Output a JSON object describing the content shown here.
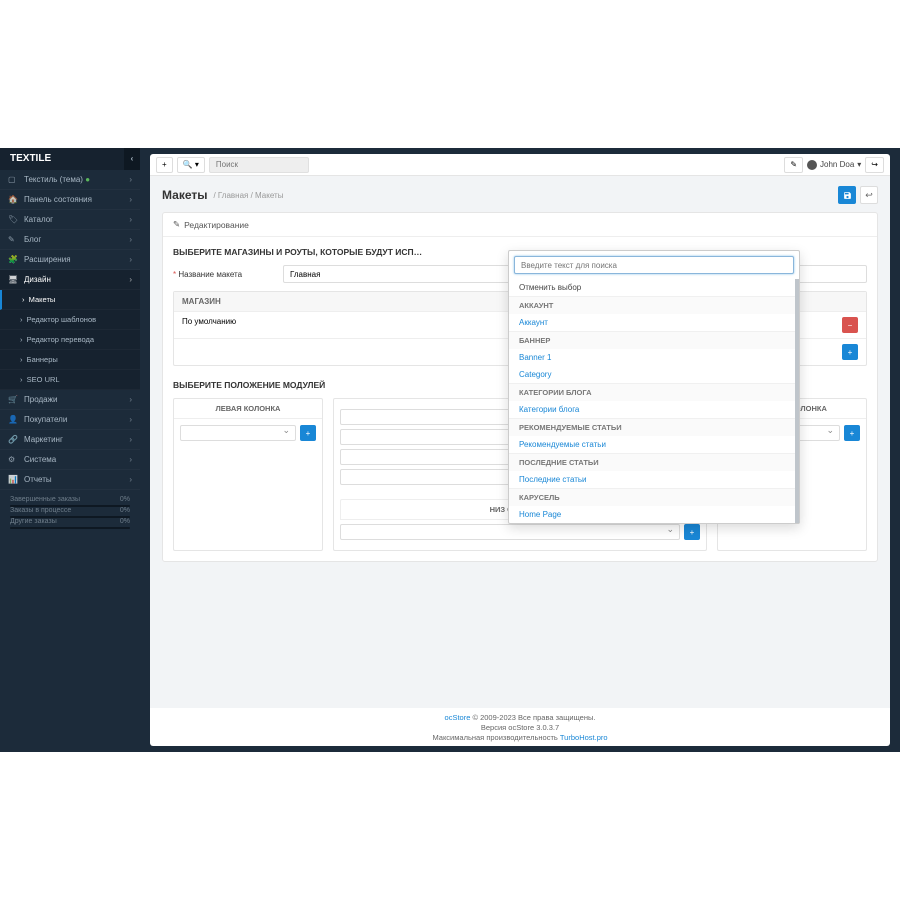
{
  "brand": "TEXTILE",
  "header": {
    "search_placeholder": "Поиск",
    "user_name": "John Doa"
  },
  "sidebar": {
    "items": [
      {
        "icon": "▢",
        "label": "Текстиль (тема)",
        "dot": true
      },
      {
        "icon": "🏠",
        "label": "Панель состояния"
      },
      {
        "icon": "🏷",
        "label": "Каталог"
      },
      {
        "icon": "✎",
        "label": "Блог"
      },
      {
        "icon": "🧩",
        "label": "Расширения"
      },
      {
        "icon": "🖥",
        "label": "Дизайн",
        "open": true
      },
      {
        "icon": "🛒",
        "label": "Продажи"
      },
      {
        "icon": "👤",
        "label": "Покупатели"
      },
      {
        "icon": "🔗",
        "label": "Маркетинг"
      },
      {
        "icon": "⚙",
        "label": "Система"
      },
      {
        "icon": "📊",
        "label": "Отчеты"
      }
    ],
    "design_sub": [
      {
        "label": "Макеты",
        "active": true
      },
      {
        "label": "Редактор шаблонов"
      },
      {
        "label": "Редактор перевода"
      },
      {
        "label": "Баннеры"
      },
      {
        "label": "SEO URL"
      }
    ],
    "status": [
      {
        "label": "Завершенные заказы",
        "pct": "0%"
      },
      {
        "label": "Заказы в процессе",
        "pct": "0%"
      },
      {
        "label": "Другие заказы",
        "pct": "0%"
      }
    ]
  },
  "page": {
    "title": "Макеты",
    "crumb1": "Главная",
    "crumb2": "Макеты",
    "panel_title": "Редактирование",
    "section1": "ВЫБЕРИТЕ МАГАЗИНЫ И РОУТЫ, КОТОРЫЕ БУДУТ ИСП…",
    "name_label": "Название макета",
    "name_value": "Главная",
    "th_shop": "МАГАЗИН",
    "td_shop": "По умолчанию",
    "section2": "ВЫБЕРИТЕ ПОЛОЖЕНИЕ МОДУЛЕЙ",
    "col_left": "ЛЕВАЯ КОЛОНКА",
    "col_right": "ПРАВАЯ КОЛОНКА",
    "col_bottom": "НИЗ СТРАНИЦЫ"
  },
  "dropdown": {
    "search_placeholder": "Введите текст для поиска",
    "clear": "Отменить выбор",
    "groups": [
      {
        "title": "АККАУНТ",
        "items": [
          "Аккаунт"
        ]
      },
      {
        "title": "БАННЕР",
        "items": [
          "Banner 1",
          "Category"
        ]
      },
      {
        "title": "КАТЕГОРИИ БЛОГА",
        "items": [
          "Категории блога"
        ]
      },
      {
        "title": "РЕКОМЕНДУЕМЫЕ СТАТЬИ",
        "items": [
          "Рекомендуемые статьи"
        ]
      },
      {
        "title": "ПОСЛЕДНИЕ СТАТЬИ",
        "items": [
          "Последние статьи"
        ]
      },
      {
        "title": "КАРУСЕЛЬ",
        "items": [
          "Home Page"
        ]
      }
    ]
  },
  "footer": {
    "l1a": "ocStore",
    "l1b": " © 2009-2023 Все права защищены.",
    "l2": "Версия ocStore 3.0.3.7",
    "l3a": "Максимальная производительность ",
    "l3b": "TurboHost.pro"
  }
}
